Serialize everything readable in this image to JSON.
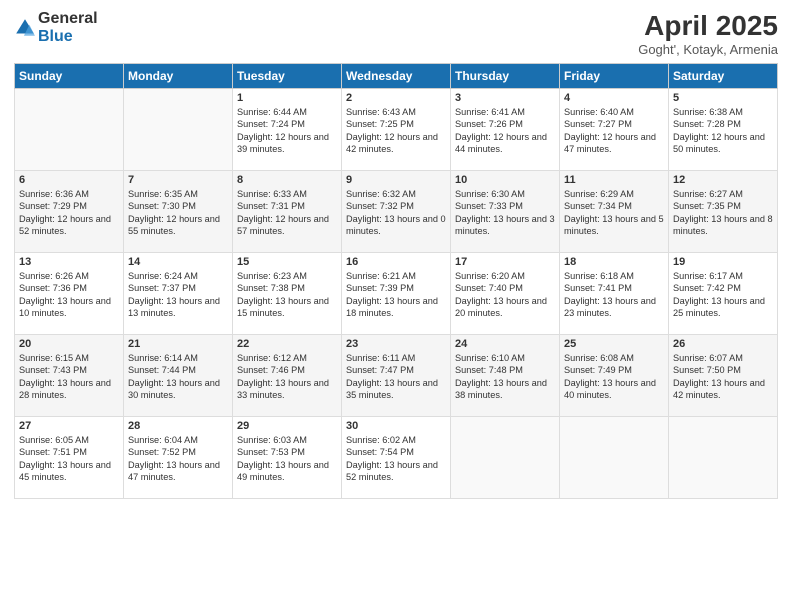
{
  "logo": {
    "general": "General",
    "blue": "Blue"
  },
  "title": "April 2025",
  "location": "Goght', Kotayk, Armenia",
  "days_of_week": [
    "Sunday",
    "Monday",
    "Tuesday",
    "Wednesday",
    "Thursday",
    "Friday",
    "Saturday"
  ],
  "weeks": [
    [
      {
        "day": "",
        "text": ""
      },
      {
        "day": "",
        "text": ""
      },
      {
        "day": "1",
        "text": "Sunrise: 6:44 AM\nSunset: 7:24 PM\nDaylight: 12 hours and 39 minutes."
      },
      {
        "day": "2",
        "text": "Sunrise: 6:43 AM\nSunset: 7:25 PM\nDaylight: 12 hours and 42 minutes."
      },
      {
        "day": "3",
        "text": "Sunrise: 6:41 AM\nSunset: 7:26 PM\nDaylight: 12 hours and 44 minutes."
      },
      {
        "day": "4",
        "text": "Sunrise: 6:40 AM\nSunset: 7:27 PM\nDaylight: 12 hours and 47 minutes."
      },
      {
        "day": "5",
        "text": "Sunrise: 6:38 AM\nSunset: 7:28 PM\nDaylight: 12 hours and 50 minutes."
      }
    ],
    [
      {
        "day": "6",
        "text": "Sunrise: 6:36 AM\nSunset: 7:29 PM\nDaylight: 12 hours and 52 minutes."
      },
      {
        "day": "7",
        "text": "Sunrise: 6:35 AM\nSunset: 7:30 PM\nDaylight: 12 hours and 55 minutes."
      },
      {
        "day": "8",
        "text": "Sunrise: 6:33 AM\nSunset: 7:31 PM\nDaylight: 12 hours and 57 minutes."
      },
      {
        "day": "9",
        "text": "Sunrise: 6:32 AM\nSunset: 7:32 PM\nDaylight: 13 hours and 0 minutes."
      },
      {
        "day": "10",
        "text": "Sunrise: 6:30 AM\nSunset: 7:33 PM\nDaylight: 13 hours and 3 minutes."
      },
      {
        "day": "11",
        "text": "Sunrise: 6:29 AM\nSunset: 7:34 PM\nDaylight: 13 hours and 5 minutes."
      },
      {
        "day": "12",
        "text": "Sunrise: 6:27 AM\nSunset: 7:35 PM\nDaylight: 13 hours and 8 minutes."
      }
    ],
    [
      {
        "day": "13",
        "text": "Sunrise: 6:26 AM\nSunset: 7:36 PM\nDaylight: 13 hours and 10 minutes."
      },
      {
        "day": "14",
        "text": "Sunrise: 6:24 AM\nSunset: 7:37 PM\nDaylight: 13 hours and 13 minutes."
      },
      {
        "day": "15",
        "text": "Sunrise: 6:23 AM\nSunset: 7:38 PM\nDaylight: 13 hours and 15 minutes."
      },
      {
        "day": "16",
        "text": "Sunrise: 6:21 AM\nSunset: 7:39 PM\nDaylight: 13 hours and 18 minutes."
      },
      {
        "day": "17",
        "text": "Sunrise: 6:20 AM\nSunset: 7:40 PM\nDaylight: 13 hours and 20 minutes."
      },
      {
        "day": "18",
        "text": "Sunrise: 6:18 AM\nSunset: 7:41 PM\nDaylight: 13 hours and 23 minutes."
      },
      {
        "day": "19",
        "text": "Sunrise: 6:17 AM\nSunset: 7:42 PM\nDaylight: 13 hours and 25 minutes."
      }
    ],
    [
      {
        "day": "20",
        "text": "Sunrise: 6:15 AM\nSunset: 7:43 PM\nDaylight: 13 hours and 28 minutes."
      },
      {
        "day": "21",
        "text": "Sunrise: 6:14 AM\nSunset: 7:44 PM\nDaylight: 13 hours and 30 minutes."
      },
      {
        "day": "22",
        "text": "Sunrise: 6:12 AM\nSunset: 7:46 PM\nDaylight: 13 hours and 33 minutes."
      },
      {
        "day": "23",
        "text": "Sunrise: 6:11 AM\nSunset: 7:47 PM\nDaylight: 13 hours and 35 minutes."
      },
      {
        "day": "24",
        "text": "Sunrise: 6:10 AM\nSunset: 7:48 PM\nDaylight: 13 hours and 38 minutes."
      },
      {
        "day": "25",
        "text": "Sunrise: 6:08 AM\nSunset: 7:49 PM\nDaylight: 13 hours and 40 minutes."
      },
      {
        "day": "26",
        "text": "Sunrise: 6:07 AM\nSunset: 7:50 PM\nDaylight: 13 hours and 42 minutes."
      }
    ],
    [
      {
        "day": "27",
        "text": "Sunrise: 6:05 AM\nSunset: 7:51 PM\nDaylight: 13 hours and 45 minutes."
      },
      {
        "day": "28",
        "text": "Sunrise: 6:04 AM\nSunset: 7:52 PM\nDaylight: 13 hours and 47 minutes."
      },
      {
        "day": "29",
        "text": "Sunrise: 6:03 AM\nSunset: 7:53 PM\nDaylight: 13 hours and 49 minutes."
      },
      {
        "day": "30",
        "text": "Sunrise: 6:02 AM\nSunset: 7:54 PM\nDaylight: 13 hours and 52 minutes."
      },
      {
        "day": "",
        "text": ""
      },
      {
        "day": "",
        "text": ""
      },
      {
        "day": "",
        "text": ""
      }
    ]
  ]
}
